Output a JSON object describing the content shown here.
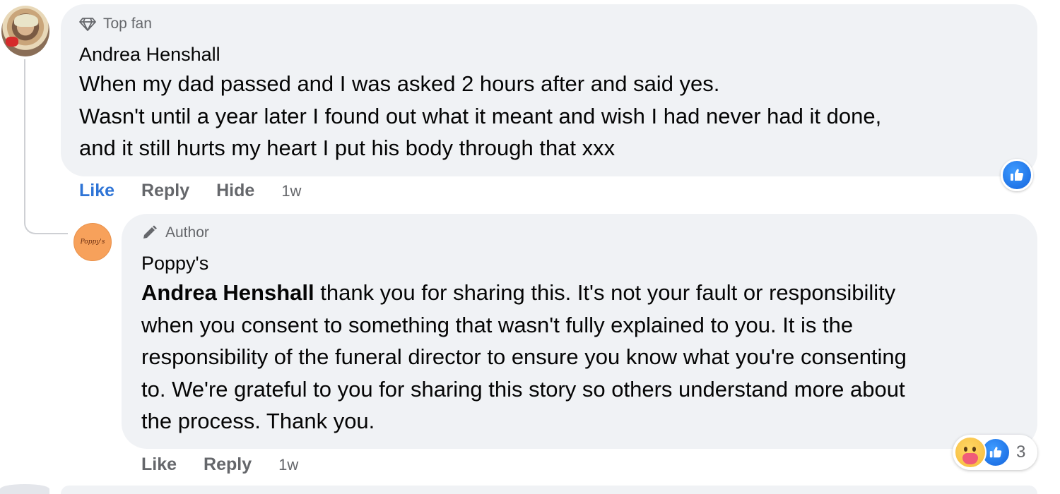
{
  "comments": [
    {
      "badge": "Top fan",
      "badge_icon": "diamond-icon",
      "author": "Andrea Henshall",
      "lines": [
        "When my dad passed and I was asked 2 hours after and said yes.",
        "Wasn't until a year later I found out what it meant and wish I had never had it done,",
        "and it still hurts my heart I put his body through that xxx"
      ],
      "actions": {
        "like": "Like",
        "reply": "Reply",
        "hide": "Hide",
        "time": "1w"
      },
      "reaction_icon": "like-icon"
    },
    {
      "badge": "Author",
      "badge_icon": "pencil-icon",
      "author": "Poppy's",
      "avatar_text": "Poppy's",
      "mention": "Andrea Henshall",
      "first_line_rest": " thank you for sharing this. It's not your fault or responsibility",
      "lines": [
        "when you consent to something that wasn't fully explained to you. It is the",
        "responsibility of the funeral director to ensure you know what you're consenting",
        "to. We're grateful to you for sharing this story so others understand more about",
        "the process. Thank you."
      ],
      "actions": {
        "like": "Like",
        "reply": "Reply",
        "time": "1w"
      },
      "reaction_count": "3",
      "reaction_icons": [
        "care-icon",
        "like-icon"
      ]
    }
  ],
  "colors": {
    "bubble": "#f0f2f5",
    "like_active": "#2e74d6",
    "muted": "#65676b",
    "text": "#050505"
  }
}
